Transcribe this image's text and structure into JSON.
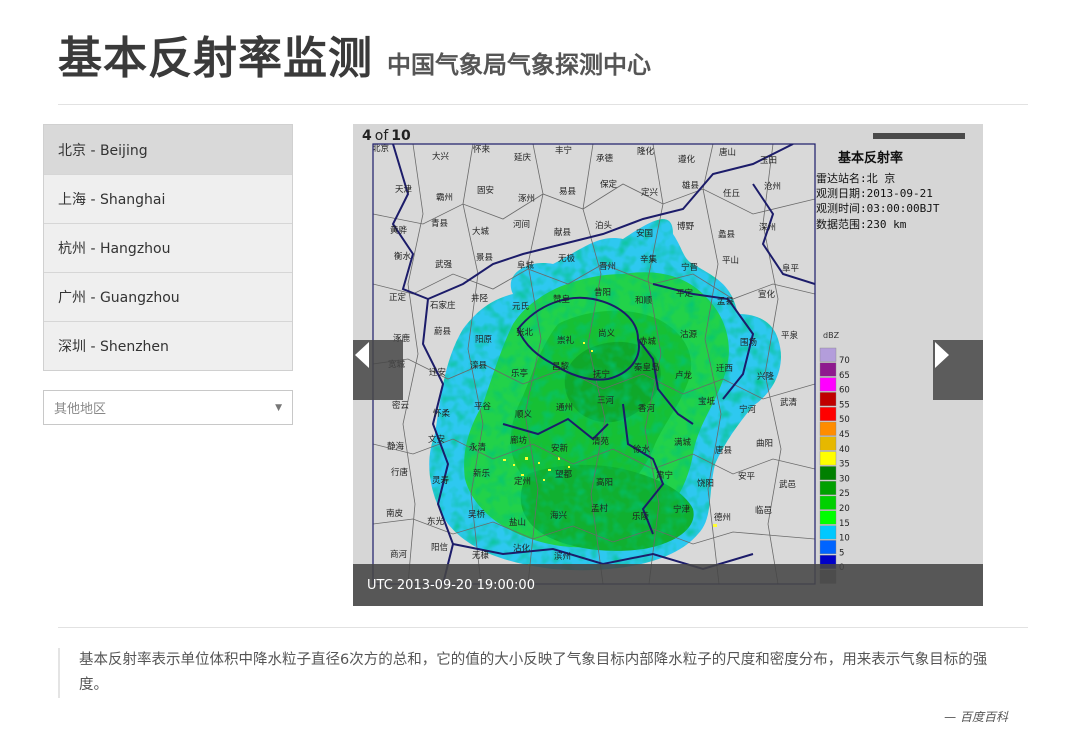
{
  "header": {
    "title": "基本反射率监测",
    "subtitle": "中国气象局气象探测中心"
  },
  "cities": [
    {
      "label": "北京 - Beijing",
      "active": true
    },
    {
      "label": "上海 - Shanghai",
      "active": false
    },
    {
      "label": "杭州 - Hangzhou",
      "active": false
    },
    {
      "label": "广州 - Guangzhou",
      "active": false
    },
    {
      "label": "深圳 - Shenzhen",
      "active": false
    }
  ],
  "region_select": {
    "placeholder": "其他地区",
    "icon": "chevron-down-icon"
  },
  "viewer": {
    "current": "4",
    "of_label": "of",
    "total": "10",
    "caption": "UTC 2013-09-20 19:00:00",
    "prev_icon": "arrow-left-icon",
    "next_icon": "arrow-right-icon"
  },
  "radar": {
    "title": "基本反射率",
    "station": "雷达站名:北 京",
    "date": "观测日期:2013-09-21",
    "time": "观测时间:03:00:00BJT",
    "range": "数据范围:230 km",
    "legend_unit": "dBZ",
    "legend": [
      {
        "label": "70",
        "color": "#b39ddb"
      },
      {
        "label": "65",
        "color": "#8e1a8e"
      },
      {
        "label": "60",
        "color": "#ff00ff"
      },
      {
        "label": "55",
        "color": "#c00000"
      },
      {
        "label": "50",
        "color": "#ff0000"
      },
      {
        "label": "45",
        "color": "#ff8c00"
      },
      {
        "label": "40",
        "color": "#e6b800"
      },
      {
        "label": "35",
        "color": "#ffff00"
      },
      {
        "label": "30",
        "color": "#008000"
      },
      {
        "label": "25",
        "color": "#00a000"
      },
      {
        "label": "20",
        "color": "#00d000"
      },
      {
        "label": "15",
        "color": "#00ff00"
      },
      {
        "label": "10",
        "color": "#00c8ff"
      },
      {
        "label": "5",
        "color": "#0064ff"
      },
      {
        "label": "0",
        "color": "#0000c8"
      },
      {
        "label": "",
        "color": "#7a7a7a"
      }
    ],
    "map_labels": [
      "北京",
      "大兴",
      "怀来",
      "延庆",
      "丰宁",
      "承德",
      "隆化",
      "遵化",
      "唐山",
      "玉田",
      "天津",
      "霸州",
      "固安",
      "涿州",
      "易县",
      "保定",
      "定兴",
      "雄县",
      "任丘",
      "沧州",
      "黄骅",
      "青县",
      "大城",
      "河间",
      "献县",
      "泊头",
      "安国",
      "博野",
      "蠡县",
      "深州",
      "衡水",
      "武强",
      "景县",
      "阜城",
      "无极",
      "晋州",
      "辛集",
      "宁晋",
      "平山",
      "阜平",
      "正定",
      "石家庄",
      "井陉",
      "元氏",
      "赞皇",
      "昔阳",
      "和顺",
      "平定",
      "盂县",
      "宣化",
      "涿鹿",
      "蔚县",
      "阳原",
      "张北",
      "崇礼",
      "尚义",
      "赤城",
      "沽源",
      "围场",
      "平泉",
      "宽城",
      "迁安",
      "滦县",
      "乐亭",
      "昌黎",
      "抚宁",
      "秦皇岛",
      "卢龙",
      "迁西",
      "兴隆",
      "密云",
      "怀柔",
      "平谷",
      "顺义",
      "通州",
      "三河",
      "香河",
      "宝坻",
      "宁河",
      "武清",
      "静海",
      "文安",
      "永清",
      "廊坊",
      "安新",
      "清苑",
      "徐水",
      "满城",
      "唐县",
      "曲阳",
      "行唐",
      "灵寿",
      "新乐",
      "定州",
      "望都",
      "高阳",
      "肃宁",
      "饶阳",
      "安平",
      "武邑",
      "南皮",
      "东光",
      "吴桥",
      "盐山",
      "海兴",
      "孟村",
      "乐陵",
      "宁津",
      "德州",
      "临邑",
      "商河",
      "阳信",
      "无棣",
      "沾化",
      "滨州"
    ]
  }
}
